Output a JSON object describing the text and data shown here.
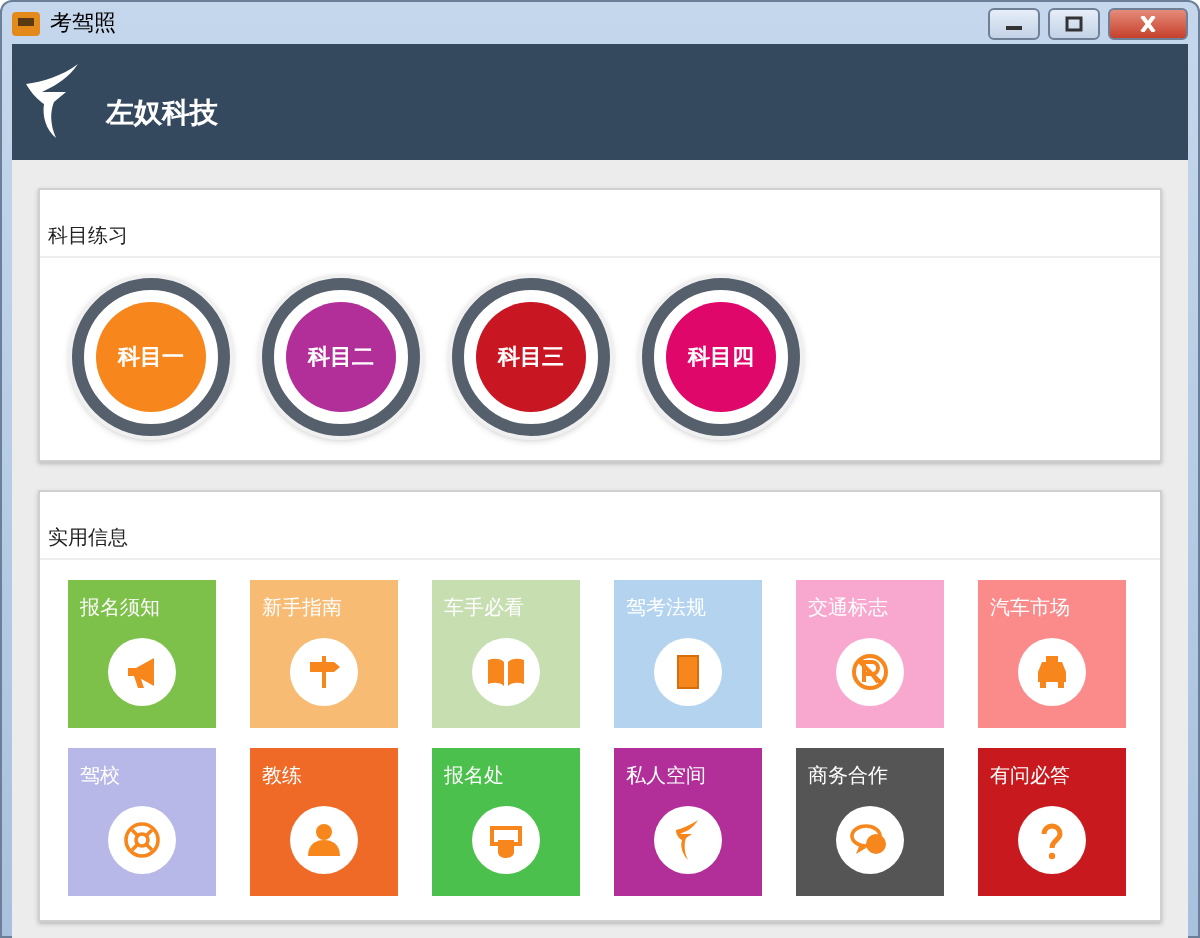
{
  "window": {
    "title": "考驾照"
  },
  "header": {
    "brand": "左奴科技"
  },
  "subjects": {
    "title": "科目练习",
    "items": [
      {
        "label": "科目一",
        "color": "#f7861c"
      },
      {
        "label": "科目二",
        "color": "#b22e98"
      },
      {
        "label": "科目三",
        "color": "#c81623"
      },
      {
        "label": "科目四",
        "color": "#e0076a"
      }
    ]
  },
  "info": {
    "title": "实用信息",
    "tiles": [
      {
        "label": "报名须知",
        "color": "#7dc04a"
      },
      {
        "label": "新手指南",
        "color": "#f8bb74"
      },
      {
        "label": "车手必看",
        "color": "#c6deb0"
      },
      {
        "label": "驾考法规",
        "color": "#b3d3ef"
      },
      {
        "label": "交通标志",
        "color": "#f8a8cf"
      },
      {
        "label": "汽车市场",
        "color": "#fb8b8b"
      },
      {
        "label": "驾校",
        "color": "#b7b7e8"
      },
      {
        "label": "教练",
        "color": "#f06a27"
      },
      {
        "label": "报名处",
        "color": "#4cc04c"
      },
      {
        "label": "私人空间",
        "color": "#b22e98"
      },
      {
        "label": "商务合作",
        "color": "#555555"
      },
      {
        "label": "有问必答",
        "color": "#c81a1e"
      }
    ]
  }
}
